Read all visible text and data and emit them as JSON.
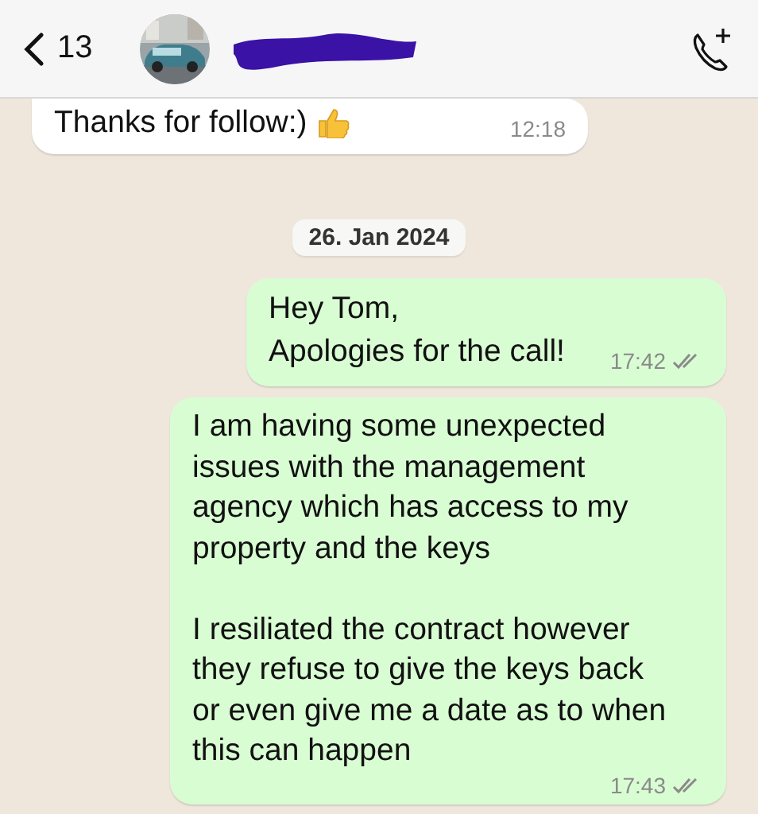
{
  "header": {
    "back_count": "13",
    "contact_redacted": true
  },
  "messages": [
    {
      "kind": "incoming",
      "paragraphs": [
        [
          "Thanks for follow:)"
        ]
      ],
      "thumbs_up": true,
      "time": "12:18"
    },
    {
      "kind": "date",
      "text": "26. Jan 2024"
    },
    {
      "kind": "outgoing",
      "paragraphs": [
        [
          "Hey Tom,",
          "Apologies for the call!"
        ]
      ],
      "time": "17:42",
      "read": false
    },
    {
      "kind": "outgoing",
      "paragraphs": [
        [
          "I am having some unexpected",
          "issues with the management",
          "agency which has access to my",
          "property and the keys"
        ],
        [
          "I resiliated the contract however",
          "they refuse to give the keys back",
          "or even give me a date as to when",
          "this can happen"
        ]
      ],
      "time": "17:43",
      "read": false
    }
  ]
}
